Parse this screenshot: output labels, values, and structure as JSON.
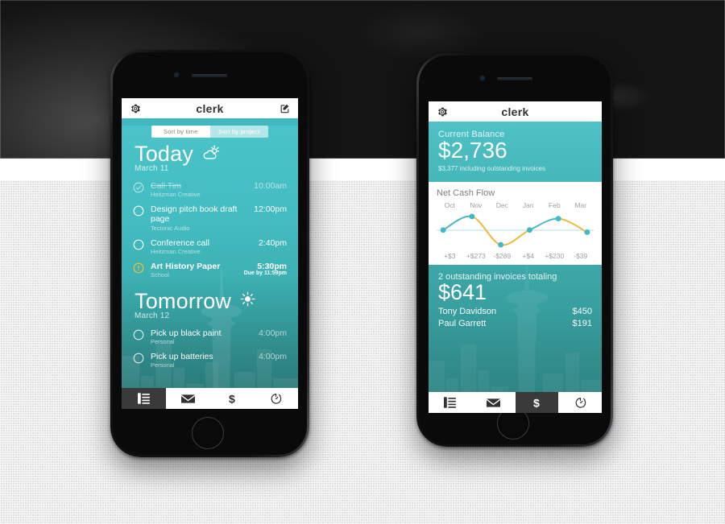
{
  "app": {
    "name": "clerk"
  },
  "left_phone": {
    "header": {
      "title": "clerk",
      "settings_icon": "gear-icon",
      "compose_icon": "compose-icon"
    },
    "sort": {
      "active": "Sort by time",
      "inactive": "Sort by project"
    },
    "today": {
      "title": "Today",
      "date": "March 11",
      "weather_icon": "partly-cloudy-icon",
      "tasks": [
        {
          "title": "Call Tim",
          "project": "Heitzman Creative",
          "time": "10:00am",
          "state": "done",
          "due": ""
        },
        {
          "title": "Design pitch book draft page",
          "project": "Tectonic Audio",
          "time": "12:00pm",
          "state": "open",
          "due": ""
        },
        {
          "title": "Conference call",
          "project": "Heitzman Creative",
          "time": "2:40pm",
          "state": "open",
          "due": ""
        },
        {
          "title": "Art History Paper",
          "project": "School",
          "time": "5:30pm",
          "state": "alert",
          "due": "Due by 11:59pm"
        }
      ]
    },
    "tomorrow": {
      "title": "Tomorrow",
      "date": "March 12",
      "weather_icon": "sunny-icon",
      "tasks": [
        {
          "title": "Pick up black paint",
          "project": "Personal",
          "time": "4:00pm",
          "state": "open",
          "due": ""
        },
        {
          "title": "Pick up batteries",
          "project": "Personal",
          "time": "4:00pm",
          "state": "open",
          "due": ""
        }
      ]
    },
    "tabs": [
      {
        "name": "list-tab",
        "icon": "list-icon",
        "active": true
      },
      {
        "name": "mail-tab",
        "icon": "envelope-icon",
        "active": false
      },
      {
        "name": "money-tab",
        "icon": "dollar-icon",
        "active": false
      },
      {
        "name": "timer-tab",
        "icon": "timer-icon",
        "active": false
      }
    ]
  },
  "right_phone": {
    "header": {
      "title": "clerk",
      "settings_icon": "gear-icon"
    },
    "balance": {
      "label": "Current Balance",
      "amount": "$2,736",
      "sub": "$3,377 including outstanding invoices"
    },
    "invoices": {
      "label": "2 outstanding invoices totaling",
      "amount": "$641",
      "rows": [
        {
          "name": "Tony Davidson",
          "amount": "$450"
        },
        {
          "name": "Paul Garrett",
          "amount": "$191"
        }
      ]
    },
    "tabs": [
      {
        "name": "list-tab",
        "icon": "list-icon",
        "active": false
      },
      {
        "name": "mail-tab",
        "icon": "envelope-icon",
        "active": false
      },
      {
        "name": "money-tab",
        "icon": "dollar-icon",
        "active": true
      },
      {
        "name": "timer-tab",
        "icon": "timer-icon",
        "active": false
      }
    ]
  },
  "chart_data": {
    "type": "line",
    "title": "Net Cash Flow",
    "categories": [
      "Oct",
      "Nov",
      "Dec",
      "Jan",
      "Feb",
      "Mar"
    ],
    "values": [
      3,
      273,
      -289,
      4,
      230,
      -39
    ],
    "labels": [
      "+$3",
      "+$273",
      "-$289",
      "+$4",
      "+$230",
      "-$39"
    ],
    "xlabel": "",
    "ylabel": "",
    "ylim": [
      -320,
      320
    ],
    "grid": false,
    "zero_line": true,
    "legend": "none",
    "positive_color": "#4db8c4",
    "negative_color": "#f0b93c",
    "point_color": "#41b8c6",
    "zero_line_color": "#b9dfdf"
  },
  "colors": {
    "teal": "#43bdc3",
    "teal_dark": "#2d8d8b",
    "accent_yellow": "#f3c02f",
    "tab_active": "#3a3a3a",
    "card_bg": "#ffffff",
    "muted_text": "#9aa0a2"
  }
}
